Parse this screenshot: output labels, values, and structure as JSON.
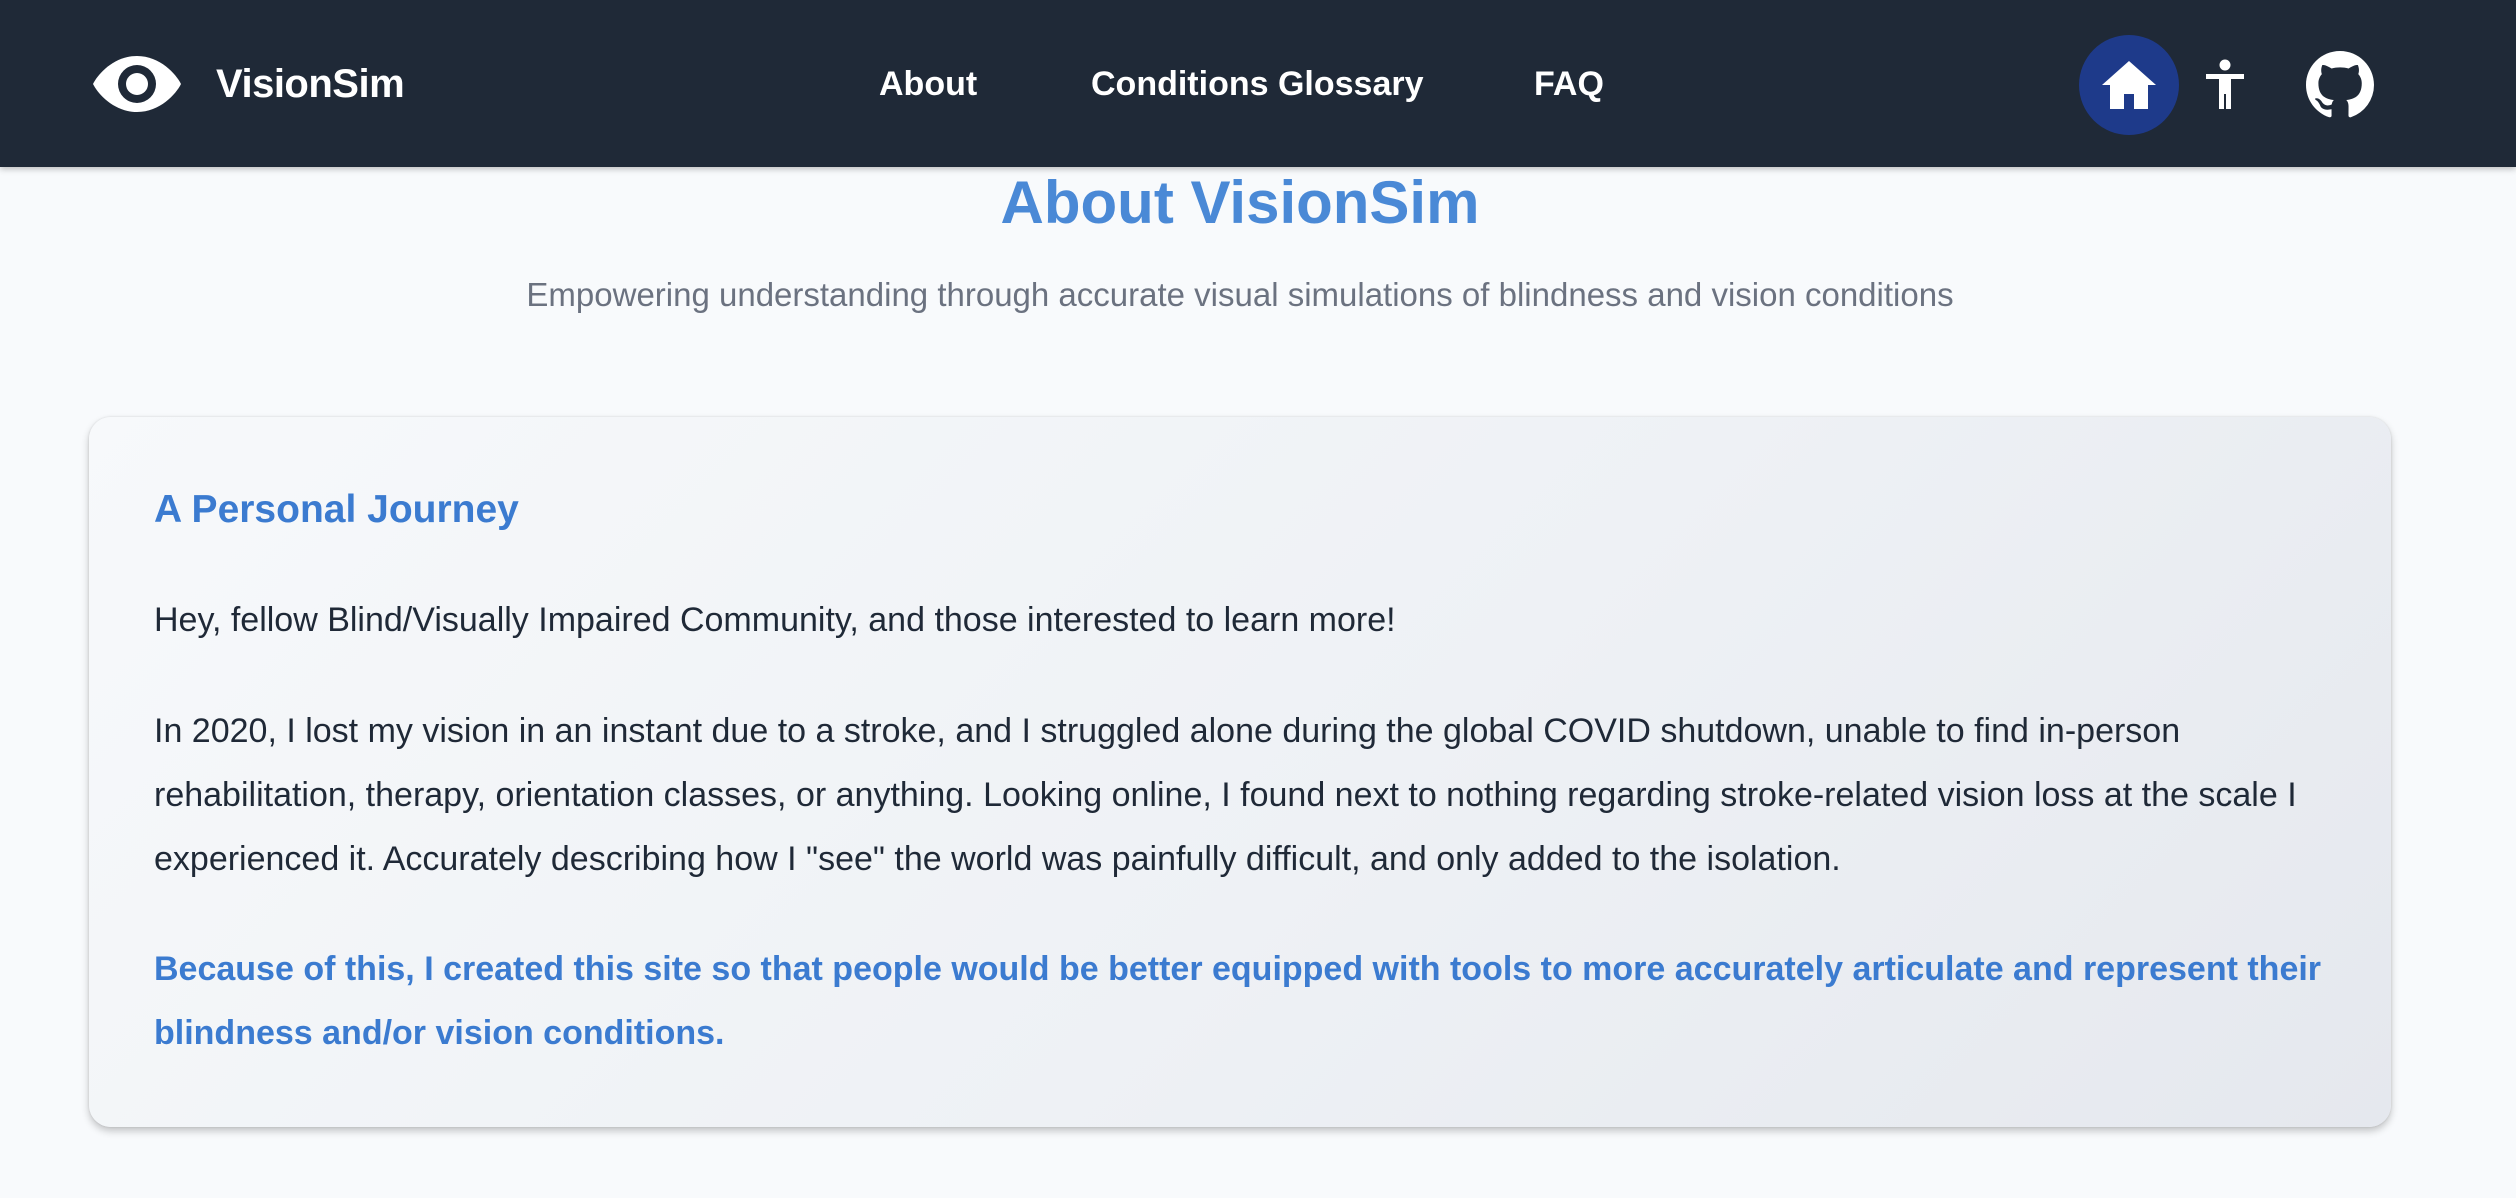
{
  "nav": {
    "brand": "VisionSim",
    "links": [
      "About",
      "Conditions Glossary",
      "FAQ"
    ],
    "icons": {
      "logo": "eye-icon",
      "home": "home-icon",
      "accessibility": "accessibility-icon",
      "github": "github-icon"
    }
  },
  "page": {
    "title": "About VisionSim",
    "subtitle": "Empowering understanding through accurate visual simulations of blindness and vision conditions"
  },
  "card": {
    "heading": "A Personal Journey",
    "paragraphs": [
      "Hey, fellow Blind/Visually Impaired Community, and those interested to learn more!",
      "In 2020, I lost my vision in an instant due to a stroke, and I struggled alone during the global COVID shutdown, unable to find in-person rehabilitation, therapy, orientation classes, or anything. Looking online, I found next to nothing regarding stroke-related vision loss at the scale I experienced it. Accurately describing how I \"see\" the world was painfully difficult, and only added to the isolation."
    ],
    "highlight": "Because of this, I created this site so that people would be better equipped with tools to more accurately articulate and represent their blindness and/or vision conditions."
  },
  "colors": {
    "navbar": "#1f2937",
    "accent": "#4a89d6",
    "home_button": "#1e3a8a",
    "background": "#f8fafc"
  }
}
